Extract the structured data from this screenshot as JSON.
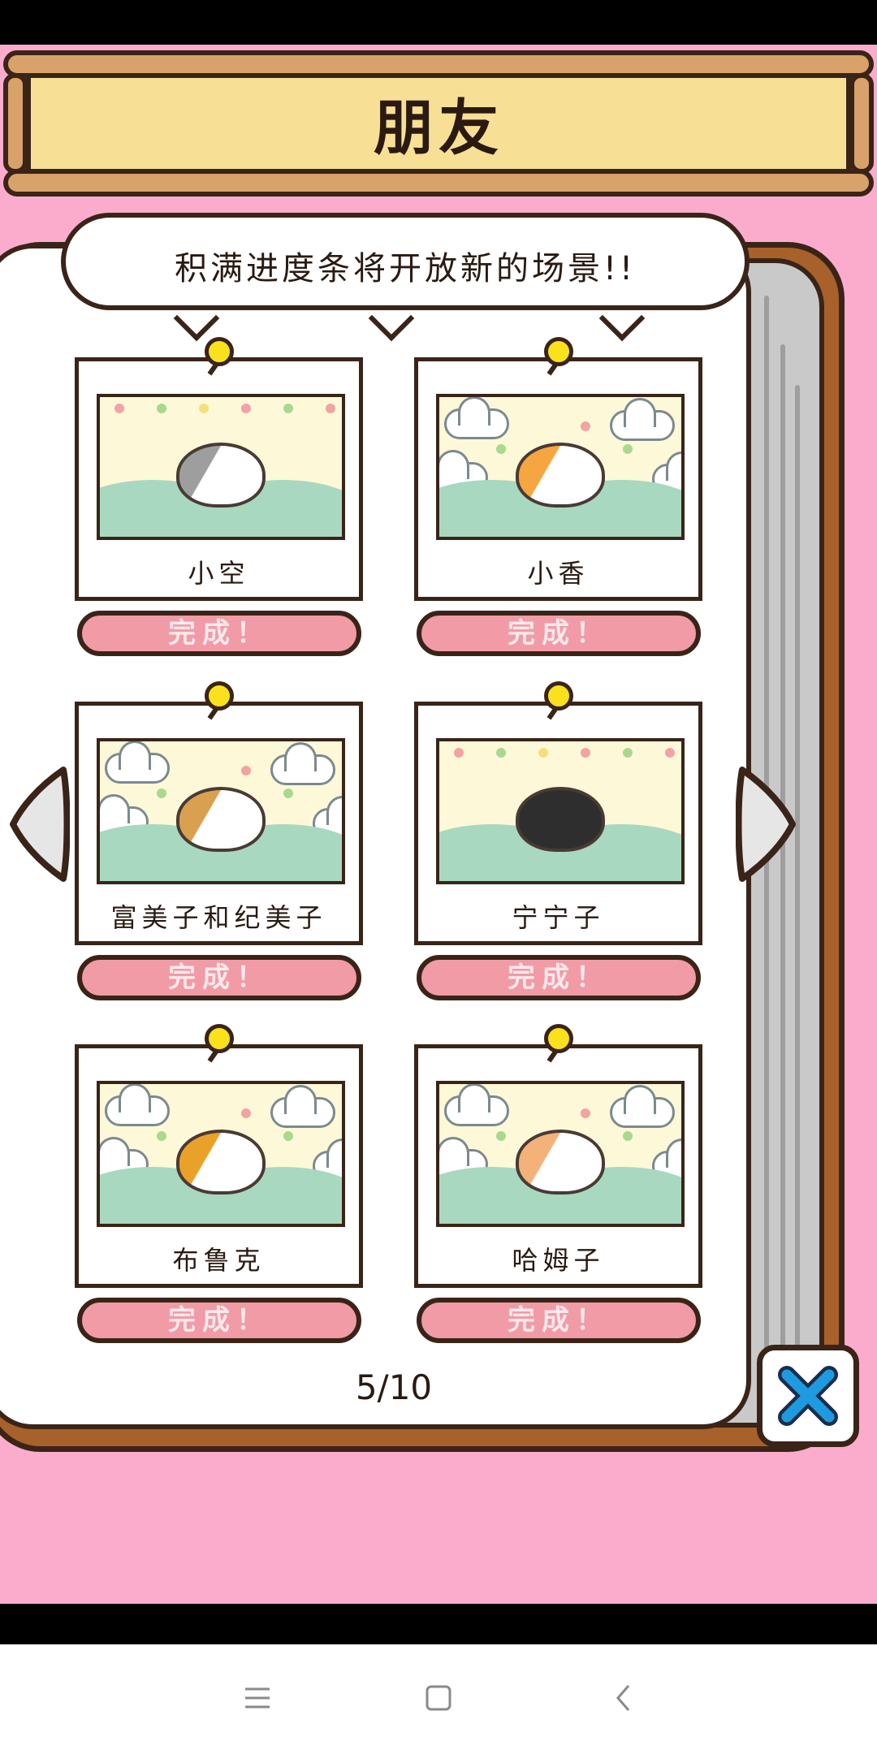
{
  "title": "朋友",
  "banner": "积满进度条将开放新的场景!!",
  "cats": [
    {
      "name": "小空",
      "button": "完成！",
      "scene": "plain",
      "cat_color": "#FFFFFF",
      "patch_color": "#9E9E9E"
    },
    {
      "name": "小香",
      "button": "完成！",
      "scene": "clouds",
      "cat_color": "#FFFFFF",
      "patch_color": "#F5A640"
    },
    {
      "name": "富美子和纪美子",
      "button": "完成！",
      "scene": "clouds",
      "cat_color": "#FFFFFF",
      "patch_color": "#D9A050"
    },
    {
      "name": "宁宁子",
      "button": "完成！",
      "scene": "plain",
      "cat_color": "#2E2E2E",
      "patch_color": "#2E2E2E"
    },
    {
      "name": "布鲁克",
      "button": "完成！",
      "scene": "clouds",
      "cat_color": "#FFFFFF",
      "patch_color": "#EAA12A"
    },
    {
      "name": "哈姆子",
      "button": "完成！",
      "scene": "clouds",
      "cat_color": "#FFFFFF",
      "patch_color": "#F3B27A"
    }
  ],
  "page_indicator": "5/10",
  "icons": {
    "prev": "triangle-left-icon",
    "next": "triangle-right-icon",
    "close": "x-icon",
    "nav_menu": "menu-icon",
    "nav_home": "square-icon",
    "nav_back": "chevron-left-icon"
  },
  "colors": {
    "background": "#FBACCD",
    "button": "#F19BA6",
    "close_x": "#1E9BE0",
    "pin": "#F9E21B"
  }
}
